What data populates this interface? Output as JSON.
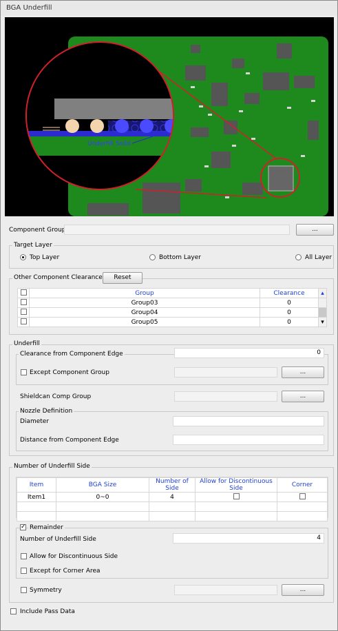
{
  "window": {
    "title": "BGA Underfill"
  },
  "preview": {
    "callout_label": "Underfill Solid"
  },
  "component_group": {
    "label": "Component Group",
    "value": "",
    "browse_label": "..."
  },
  "target_layer": {
    "title": "Target Layer",
    "options": [
      "Top Layer",
      "Bottom Layer",
      "All Layer"
    ],
    "selected": "Top Layer"
  },
  "clearance": {
    "title": "Other Component Clearance",
    "reset_label": "Reset",
    "headers": [
      "Group",
      "Clearance"
    ],
    "rows": [
      {
        "group": "Group03",
        "clearance": "0"
      },
      {
        "group": "Group04",
        "clearance": "0"
      },
      {
        "group": "Group05",
        "clearance": "0"
      }
    ]
  },
  "underfill": {
    "title": "Underfill",
    "edge_group_title": "Clearance from Component Edge",
    "edge_value": "0",
    "except_group_label": "Except Component Group",
    "except_browse": "...",
    "shieldcan_label": "Shieldcan Comp Group",
    "shieldcan_browse": "...",
    "nozzle_title": "Nozzle Definition",
    "diameter_label": "Diameter",
    "diameter_value": "",
    "distance_label": "Distance from Component Edge",
    "distance_value": ""
  },
  "sides": {
    "title": "Number of Underfill Side",
    "headers": [
      "Item",
      "BGA Size",
      "Number of Side",
      "Allow for Discontinuous Side",
      "Corner"
    ],
    "rows": [
      {
        "item": "Item1",
        "bga_size": "0~0",
        "num_side": "4",
        "allow": false,
        "corner": false
      }
    ],
    "remainder_label": "Remainder",
    "remainder_checked": true,
    "num_side_label": "Number of Underfill Side",
    "num_side_value": "4",
    "allow_label": "Allow for Discontinuous Side",
    "corner_label": "Except for Corner Area",
    "symmetry_label": "Symmetry",
    "symmetry_browse": "..."
  },
  "include_pass_label": "Include Pass Data",
  "colors": {
    "header_text": "#1f3fd6",
    "board_green": "#1e8a1e",
    "ring_red": "#d0202a",
    "solder_peach": "#f4d4ad",
    "underfill_blue": "#2b2bd0"
  }
}
